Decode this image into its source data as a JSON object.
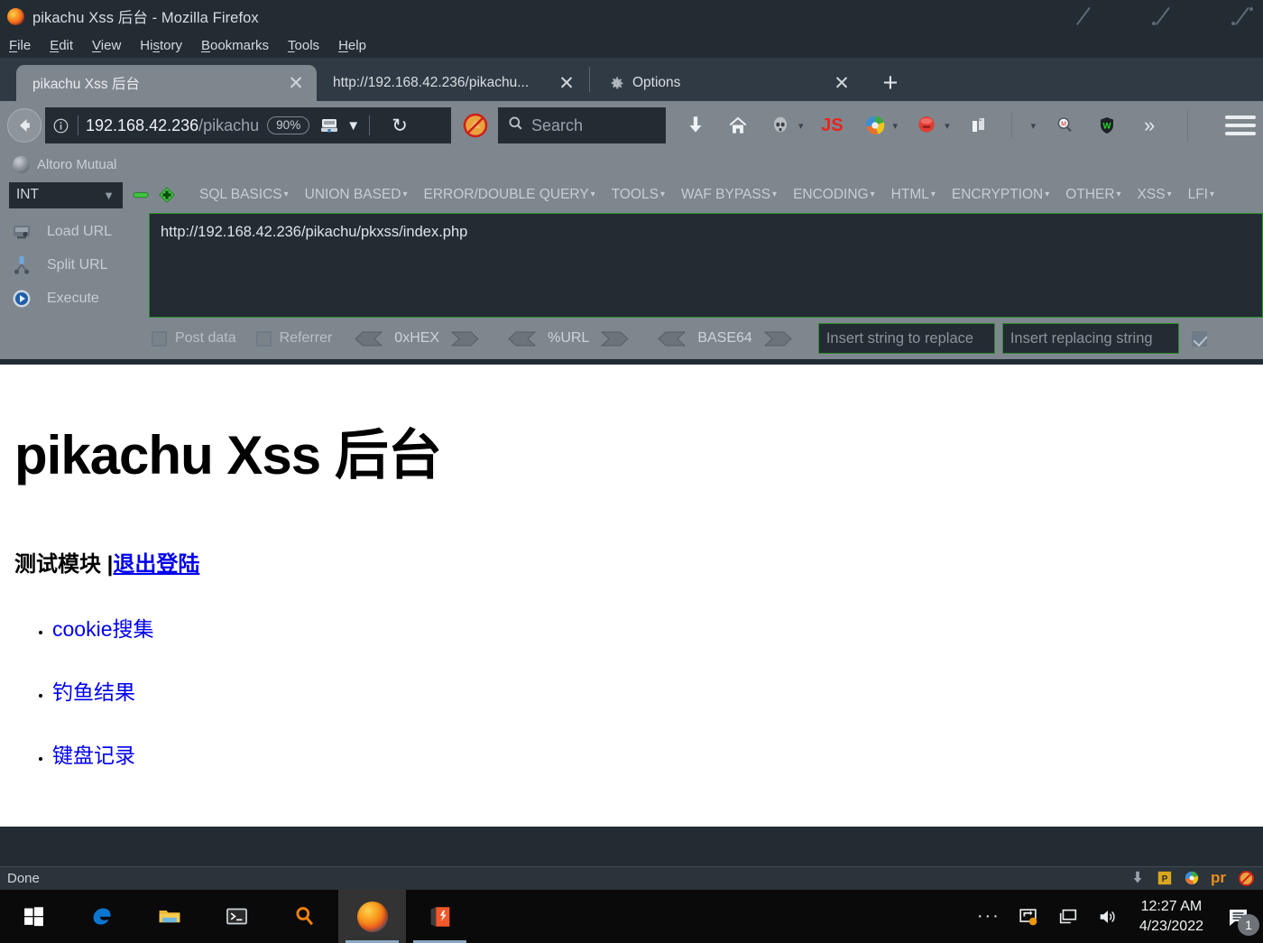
{
  "window": {
    "title": "pikachu Xss 后台 - Mozilla Firefox",
    "favicon": "firefox-logo-icon",
    "controls": [
      {
        "name": "minimize-button",
        "glyph": "minimize"
      },
      {
        "name": "maximize-button",
        "glyph": "maximize"
      },
      {
        "name": "close-button",
        "glyph": "close"
      }
    ]
  },
  "menubar": {
    "items": [
      {
        "label": "File",
        "accel": "F"
      },
      {
        "label": "Edit",
        "accel": "E"
      },
      {
        "label": "View",
        "accel": "V"
      },
      {
        "label": "History",
        "accel": "s"
      },
      {
        "label": "Bookmarks",
        "accel": "B"
      },
      {
        "label": "Tools",
        "accel": "T"
      },
      {
        "label": "Help",
        "accel": "H"
      }
    ]
  },
  "tabs": {
    "items": [
      {
        "label": "pikachu Xss 后台",
        "active": true,
        "close_label": "✕",
        "icon": "none"
      },
      {
        "label": "http://192.168.42.236/pikachu...",
        "active": false,
        "close_label": "✕",
        "icon": "none"
      },
      {
        "label": "Options",
        "active": false,
        "close_label": "✕",
        "icon": "gear-icon"
      }
    ],
    "new_tab_label": "+"
  },
  "navbar": {
    "back_label": "←",
    "identity_icon": "info-icon",
    "url_host": "192.168.42.236",
    "url_path": "/pikachu",
    "zoom_level": "90%",
    "reader_icon": "reader-mode-icon",
    "reader_caret": "▼",
    "reload_label": "↻",
    "noscript_icon": "noscript-disabled-icon",
    "search": {
      "placeholder": "Search",
      "icon": "search-icon"
    },
    "toolbar_icons": [
      {
        "name": "downloads-icon",
        "glyph": "⬇"
      },
      {
        "name": "home-icon",
        "glyph": "⌂"
      },
      {
        "name": "hackbar-skull-icon",
        "glyph": "skull"
      },
      {
        "name": "javascript-toggle-icon",
        "glyph": "JS"
      },
      {
        "name": "firebug-icon",
        "glyph": "firebug"
      },
      {
        "name": "hackbar-red-icon",
        "glyph": "red-ball"
      },
      {
        "name": "cookie-manager-icon",
        "glyph": "page"
      },
      {
        "name": "wappalyzer-icon",
        "glyph": "magnifier"
      },
      {
        "name": "wot-shield-icon",
        "glyph": "W"
      },
      {
        "name": "overflow-chevrons-icon",
        "glyph": "»"
      }
    ],
    "menu_label": "☰"
  },
  "bookmarks": {
    "items": [
      {
        "label": "Altoro Mutual",
        "icon": "globe-icon"
      }
    ]
  },
  "hackbar": {
    "type_select": {
      "value": "INT",
      "caret": "▼"
    },
    "minus_label": "minus-button",
    "plus_label": "plus-button",
    "menus": [
      {
        "label": "SQL BASICS",
        "caret": "▾"
      },
      {
        "label": "UNION BASED",
        "caret": "▾"
      },
      {
        "label": "ERROR/DOUBLE QUERY",
        "caret": "▾"
      },
      {
        "label": "TOOLS",
        "caret": "▾"
      },
      {
        "label": "WAF BYPASS",
        "caret": "▾"
      },
      {
        "label": "ENCODING",
        "caret": "▾"
      },
      {
        "label": "HTML",
        "caret": "▾"
      },
      {
        "label": "ENCRYPTION",
        "caret": "▾"
      },
      {
        "label": "OTHER",
        "caret": "▾"
      },
      {
        "label": "XSS",
        "caret": "▾"
      },
      {
        "label": "LFI",
        "caret": "▾"
      }
    ],
    "actions": [
      {
        "label": "Load URL",
        "icon": "load-url-icon"
      },
      {
        "label": "Split URL",
        "icon": "split-url-icon"
      },
      {
        "label": "Execute",
        "icon": "execute-icon"
      }
    ],
    "url_value": "http://192.168.42.236/pikachu/pkxss/index.php",
    "post_data": {
      "label": "Post data",
      "checked": false
    },
    "referrer": {
      "label": "Referrer",
      "checked": false
    },
    "converters": [
      {
        "label": "0xHEX"
      },
      {
        "label": "%URL"
      },
      {
        "label": "BASE64"
      }
    ],
    "replace_from_placeholder": "Insert string to replace",
    "replace_to_placeholder": "Insert replacing string",
    "replace_checkbox_checked": true
  },
  "page": {
    "heading": "pikachu Xss 后台",
    "subtitle_text": "测试模块 |",
    "logout_link": "退出登陆",
    "links": [
      {
        "label": "cookie搜集"
      },
      {
        "label": "钓鱼结果"
      },
      {
        "label": "键盘记录"
      }
    ]
  },
  "statusbar": {
    "text": "Done",
    "tray_icons": [
      {
        "name": "download-arrow-icon"
      },
      {
        "name": "pdf-p-icon"
      },
      {
        "name": "firebug-status-icon"
      },
      {
        "name": "privacy-pr-icon"
      },
      {
        "name": "noscript-status-icon"
      }
    ]
  },
  "taskbar": {
    "items": [
      {
        "name": "start-button",
        "glyph": "windows-logo-icon"
      },
      {
        "name": "edge-button",
        "glyph": "edge-icon"
      },
      {
        "name": "file-explorer-button",
        "glyph": "folder-icon"
      },
      {
        "name": "terminal-button",
        "glyph": "terminal-icon"
      },
      {
        "name": "search-button",
        "glyph": "magnifier-icon"
      },
      {
        "name": "firefox-button",
        "glyph": "firefox-icon",
        "active": true
      },
      {
        "name": "burp-suite-button",
        "glyph": "burp-icon",
        "open": true
      }
    ],
    "tray": {
      "overflow_label": "···",
      "icons": [
        {
          "name": "onedrive-sync-icon"
        },
        {
          "name": "network-icon"
        },
        {
          "name": "volume-icon"
        }
      ],
      "time": "12:27 AM",
      "date": "4/23/2022",
      "notification_count": "1"
    }
  },
  "colors": {
    "chrome_bg": "#7f878e",
    "dark_bg": "#232b33",
    "tabbar_bg": "#303a44",
    "accent_green": "#2e8b2e",
    "link_blue": "#0000ee",
    "taskbar_bg": "#0a0a0a"
  }
}
